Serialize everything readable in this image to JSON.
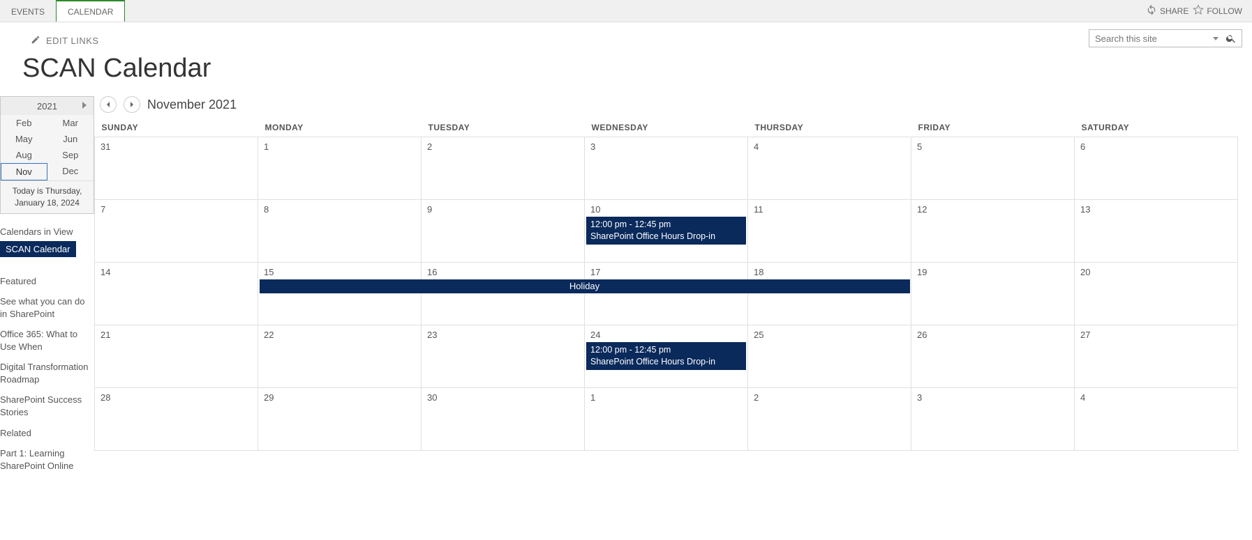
{
  "ribbon": {
    "tabs": [
      "EVENTS",
      "CALENDAR"
    ],
    "active": 1,
    "share": "SHARE",
    "follow": "FOLLOW"
  },
  "topnav": {
    "edit_links": "EDIT LINKS",
    "search_placeholder": "Search this site"
  },
  "page": {
    "title": "SCAN Calendar"
  },
  "mini": {
    "year": "2021",
    "months": [
      {
        "label": "Feb"
      },
      {
        "label": "Mar"
      },
      {
        "label": "May"
      },
      {
        "label": "Jun"
      },
      {
        "label": "Aug"
      },
      {
        "label": "Sep"
      },
      {
        "label": "Nov",
        "selected": true
      },
      {
        "label": "Dec"
      }
    ],
    "today": "Today is Thursday, January 18, 2024"
  },
  "sidebar": {
    "calendars_in_view": "Calendars in View",
    "calendar_name": "SCAN Calendar",
    "links": [
      "Featured",
      "See what you can do in SharePoint",
      "Office 365: What to Use When",
      "Digital Transformation Roadmap",
      "SharePoint Success Stories",
      "Related",
      "Part 1: Learning SharePoint Online"
    ]
  },
  "calendar": {
    "title": "November 2021",
    "day_headers": [
      "SUNDAY",
      "MONDAY",
      "TUESDAY",
      "WEDNESDAY",
      "THURSDAY",
      "FRIDAY",
      "SATURDAY"
    ],
    "weeks": [
      [
        "31",
        "1",
        "2",
        "3",
        "4",
        "5",
        "6"
      ],
      [
        "7",
        "8",
        "9",
        "10",
        "11",
        "12",
        "13"
      ],
      [
        "14",
        "15",
        "16",
        "17",
        "18",
        "19",
        "20"
      ],
      [
        "21",
        "22",
        "23",
        "24",
        "25",
        "26",
        "27"
      ],
      [
        "28",
        "29",
        "30",
        "1",
        "2",
        "3",
        "4"
      ]
    ],
    "events": {
      "w1_d3": {
        "time": "12:00 pm - 12:45 pm",
        "title": "SharePoint Office Hours Drop-in"
      },
      "w3_d3": {
        "time": "12:00 pm - 12:45 pm",
        "title": "SharePoint Office Hours Drop-in"
      },
      "holiday": {
        "title": "Holiday"
      }
    }
  }
}
